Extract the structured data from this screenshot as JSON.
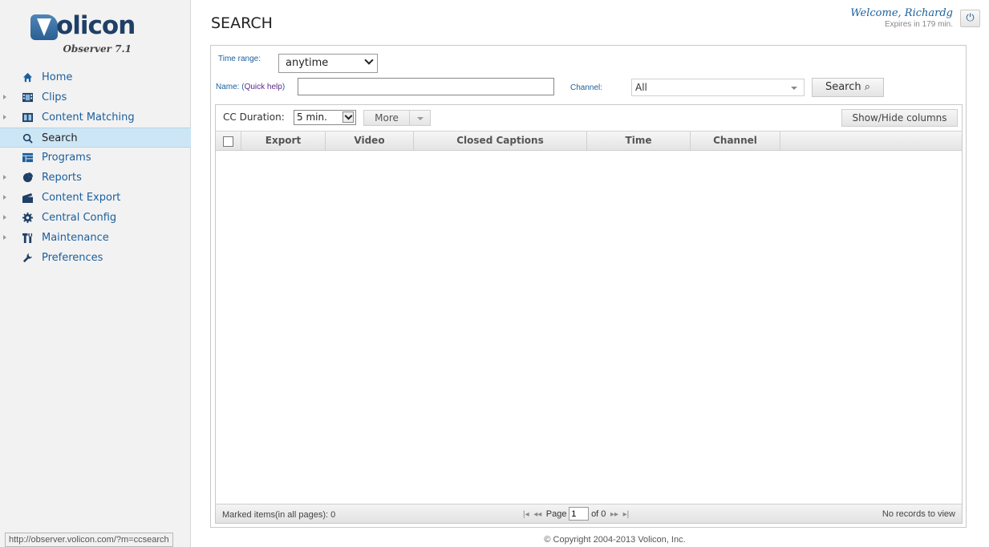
{
  "sidebar": {
    "logo": "olicon",
    "product": "Observer 7.1",
    "items": [
      {
        "label": "Home",
        "icon": "home-icon",
        "expandable": false,
        "active": false
      },
      {
        "label": "Clips",
        "icon": "film-icon",
        "expandable": true,
        "active": false
      },
      {
        "label": "Content Matching",
        "icon": "filmstrip-icon",
        "expandable": true,
        "active": false
      },
      {
        "label": "Search",
        "icon": "search-icon",
        "expandable": false,
        "active": true
      },
      {
        "label": "Programs",
        "icon": "programs-icon",
        "expandable": false,
        "active": false
      },
      {
        "label": "Reports",
        "icon": "pie-chart-icon",
        "expandable": true,
        "active": false
      },
      {
        "label": "Content Export",
        "icon": "clapperboard-icon",
        "expandable": true,
        "active": false
      },
      {
        "label": "Central Config",
        "icon": "gear-icon",
        "expandable": true,
        "active": false
      },
      {
        "label": "Maintenance",
        "icon": "tools-icon",
        "expandable": true,
        "active": false
      },
      {
        "label": "Preferences",
        "icon": "wrench-icon",
        "expandable": false,
        "active": false
      }
    ]
  },
  "header": {
    "title": "SEARCH",
    "welcome": "Welcome, Richardg",
    "expires": "Expires in 179 min."
  },
  "filters": {
    "time_range_label": "Time range:",
    "time_range_value": "anytime",
    "name_label": "Name: (",
    "quick_help": "Quick help",
    "name_label_end": ")",
    "name_value": "",
    "channel_label": "Channel:",
    "channel_value": "All",
    "search_button": "Search ⌕"
  },
  "grid": {
    "cc_duration_label": "CC Duration:",
    "cc_duration_value": "5 min.",
    "more_button": "More",
    "showhide_button": "Show/Hide columns",
    "columns": [
      "Export",
      "Video",
      "Closed Captions",
      "Time",
      "Channel"
    ],
    "marked_items": "Marked items(in all pages):   0",
    "page_label": "Page",
    "page_value": "1",
    "page_of": "of 0",
    "no_records": "No records to view"
  },
  "footer": {
    "copyright": "© Copyright 2004-2013 Volicon, Inc.",
    "status_url": "http://observer.volicon.com/?m=ccsearch"
  },
  "colors": {
    "link": "#1a5f9e",
    "active_nav_bg": "#cde6f5",
    "brand_dark": "#1f3f66"
  }
}
